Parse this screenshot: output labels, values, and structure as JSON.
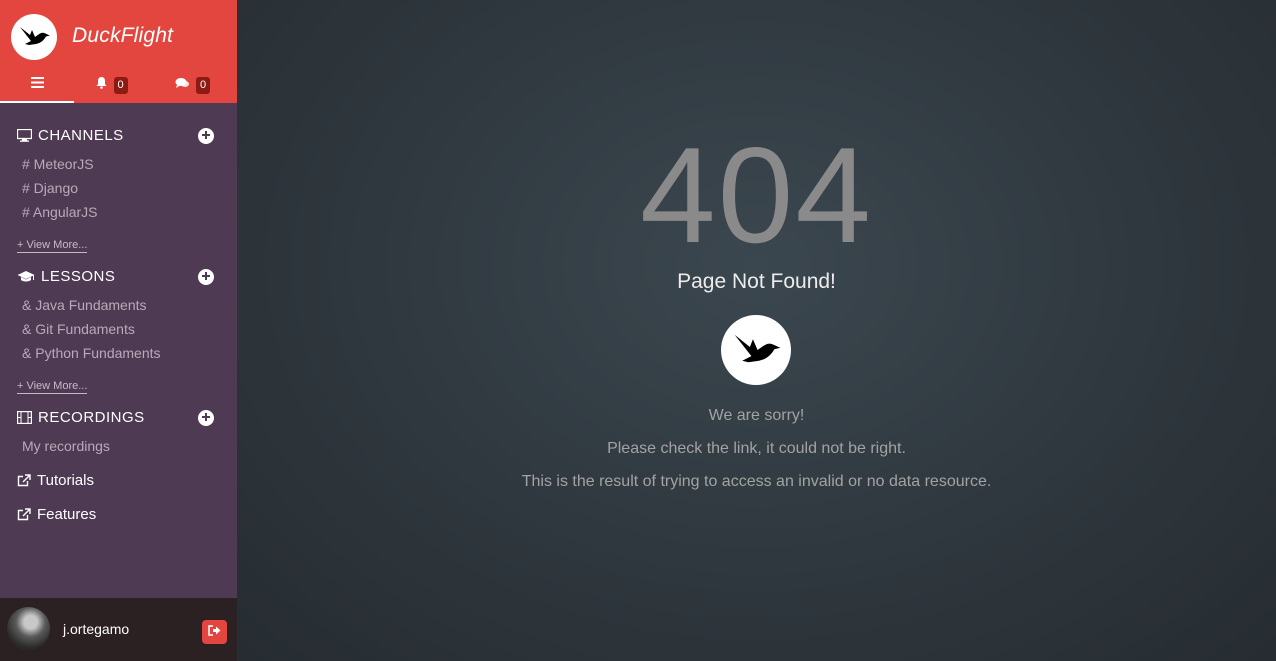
{
  "brand": {
    "name": "DuckFlight",
    "logo_icon": "duck-icon"
  },
  "topnav": {
    "menu_icon": "menu-icon",
    "notifications": {
      "icon": "bell-icon",
      "count": "0"
    },
    "messages": {
      "icon": "chat-icon",
      "count": "0"
    }
  },
  "channels": {
    "title": "CHANNELS",
    "icon": "desktop-icon",
    "items": [
      "# MeteorJS",
      "# Django",
      "# AngularJS"
    ],
    "view_more": "+ View More..."
  },
  "lessons": {
    "title": "LESSONS",
    "icon": "graduation-cap-icon",
    "items": [
      "& Java Fundaments",
      "& Git Fundaments",
      "& Python Fundaments"
    ],
    "view_more": "+ View More..."
  },
  "recordings": {
    "title": "RECORDINGS",
    "icon": "film-icon",
    "items": [
      "My recordings"
    ]
  },
  "links": [
    {
      "label": "Tutorials",
      "icon": "external-link-icon"
    },
    {
      "label": "Features",
      "icon": "external-link-icon"
    }
  ],
  "user": {
    "name": "j.ortegamo",
    "logout_icon": "logout-icon"
  },
  "error": {
    "code": "404",
    "title": "Page Not Found!",
    "line1": "We are sorry!",
    "line2": "Please check the link, it could not be right.",
    "line3": "This is the result of trying to access an invalid or no data resource."
  },
  "colors": {
    "brand": "#e3463e",
    "sidebar": "#4f3a53",
    "badge": "#8e1a14",
    "main_bg": "#313a41"
  }
}
